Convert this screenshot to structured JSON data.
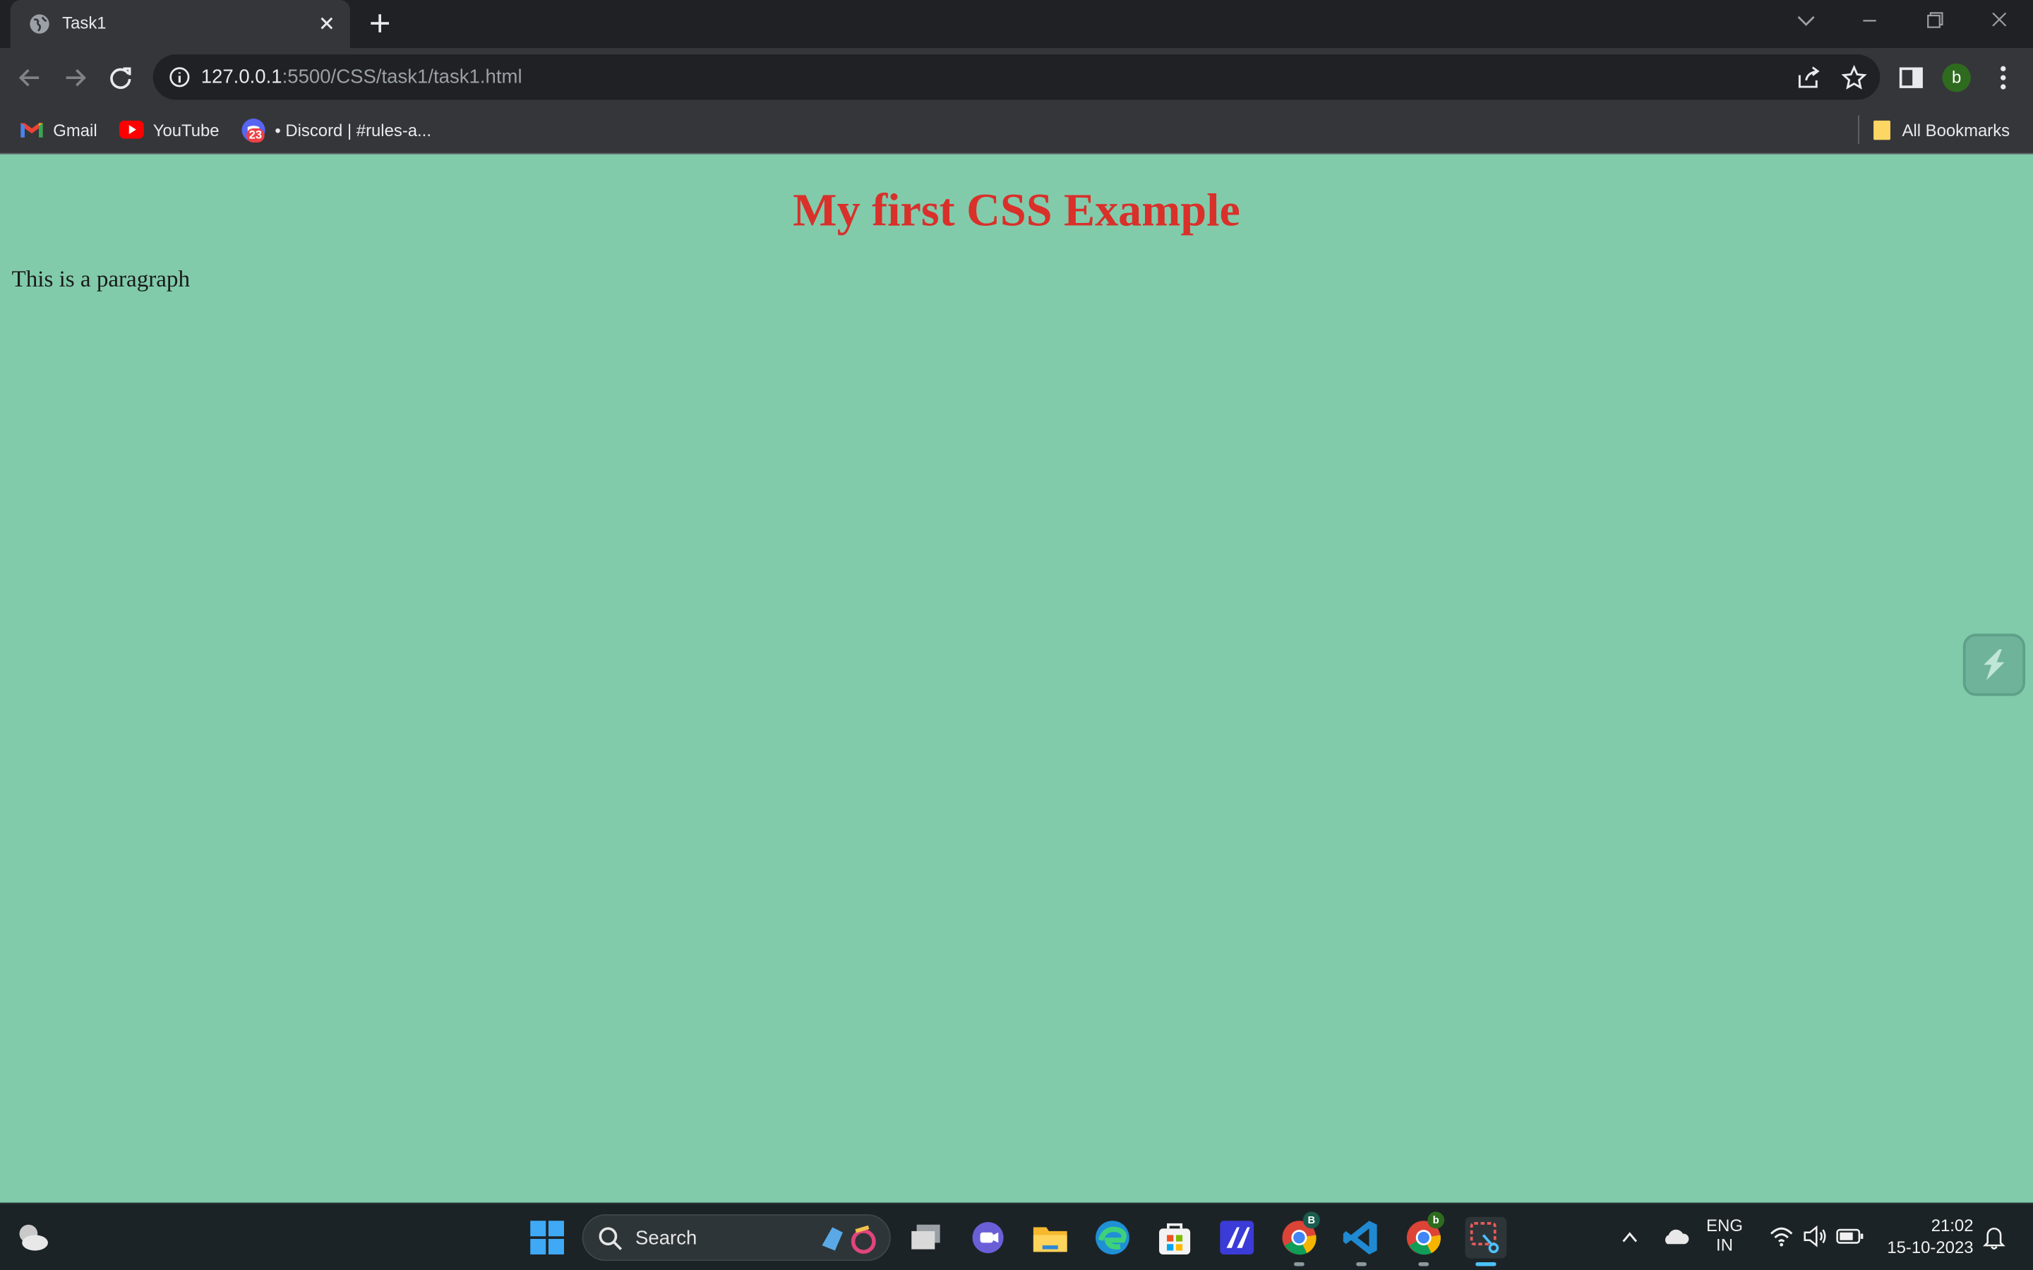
{
  "browser": {
    "tab": {
      "title": "Task1"
    },
    "address": {
      "host": "127.0.0.1",
      "rest": ":5500/CSS/task1/task1.html"
    },
    "profile_initial": "b",
    "bookmarks": [
      {
        "label": "Gmail",
        "icon": "gmail-icon"
      },
      {
        "label": "YouTube",
        "icon": "youtube-icon"
      },
      {
        "label": "• Discord | #rules-a...",
        "icon": "discord-icon",
        "badge": "23"
      }
    ],
    "all_bookmarks_label": "All Bookmarks"
  },
  "page": {
    "heading": "My first CSS Example",
    "paragraph": "This is a paragraph",
    "background": "#81cbab",
    "heading_color": "#d9302a"
  },
  "taskbar": {
    "search_label": "Search",
    "language": {
      "line1": "ENG",
      "line2": "IN"
    },
    "time": "21:02",
    "date": "15-10-2023",
    "chrome_badges": [
      "B",
      "b"
    ]
  }
}
